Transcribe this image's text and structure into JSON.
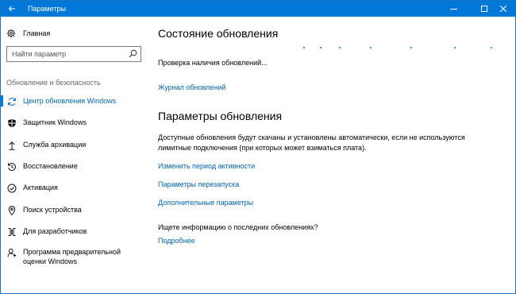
{
  "window": {
    "title": "Параметры",
    "controls": {
      "minimize": "—",
      "maximize": "☐",
      "close": "✕"
    }
  },
  "sidebar": {
    "home_label": "Главная",
    "search_placeholder": "Найти параметр",
    "section_title": "Обновление и безопасность",
    "items": [
      {
        "label": "Центр обновления Windows",
        "icon": "sync-icon",
        "active": true
      },
      {
        "label": "Защитник Windows",
        "icon": "shield-icon",
        "active": false
      },
      {
        "label": "Служба архивации",
        "icon": "backup-arrow-icon",
        "active": false
      },
      {
        "label": "Восстановление",
        "icon": "recovery-icon",
        "active": false
      },
      {
        "label": "Активация",
        "icon": "activation-check-icon",
        "active": false
      },
      {
        "label": "Поиск устройства",
        "icon": "find-device-icon",
        "active": false
      },
      {
        "label": "Для разработчиков",
        "icon": "developer-icon",
        "active": false
      },
      {
        "label": "Программа предварительной оценки Windows",
        "icon": "insider-icon",
        "active": false
      }
    ]
  },
  "main": {
    "update_status_title": "Состояние обновления",
    "status_text": "Проверка наличия обновлений...",
    "history_link": "Журнал обновлений",
    "update_settings_title": "Параметры обновления",
    "settings_description": "Доступные обновления будут скачаны и установлены автоматически, если не используются лимитные подключения (при которых может взиматься плата).",
    "links": [
      "Изменить период активности",
      "Параметры перезапуска",
      "Дополнительные параметры"
    ],
    "info_question": "Ищете информацию о последних обновлениях?",
    "more_link": "Подробнее"
  },
  "colors": {
    "accent": "#0078d7",
    "link": "#0063b1"
  }
}
